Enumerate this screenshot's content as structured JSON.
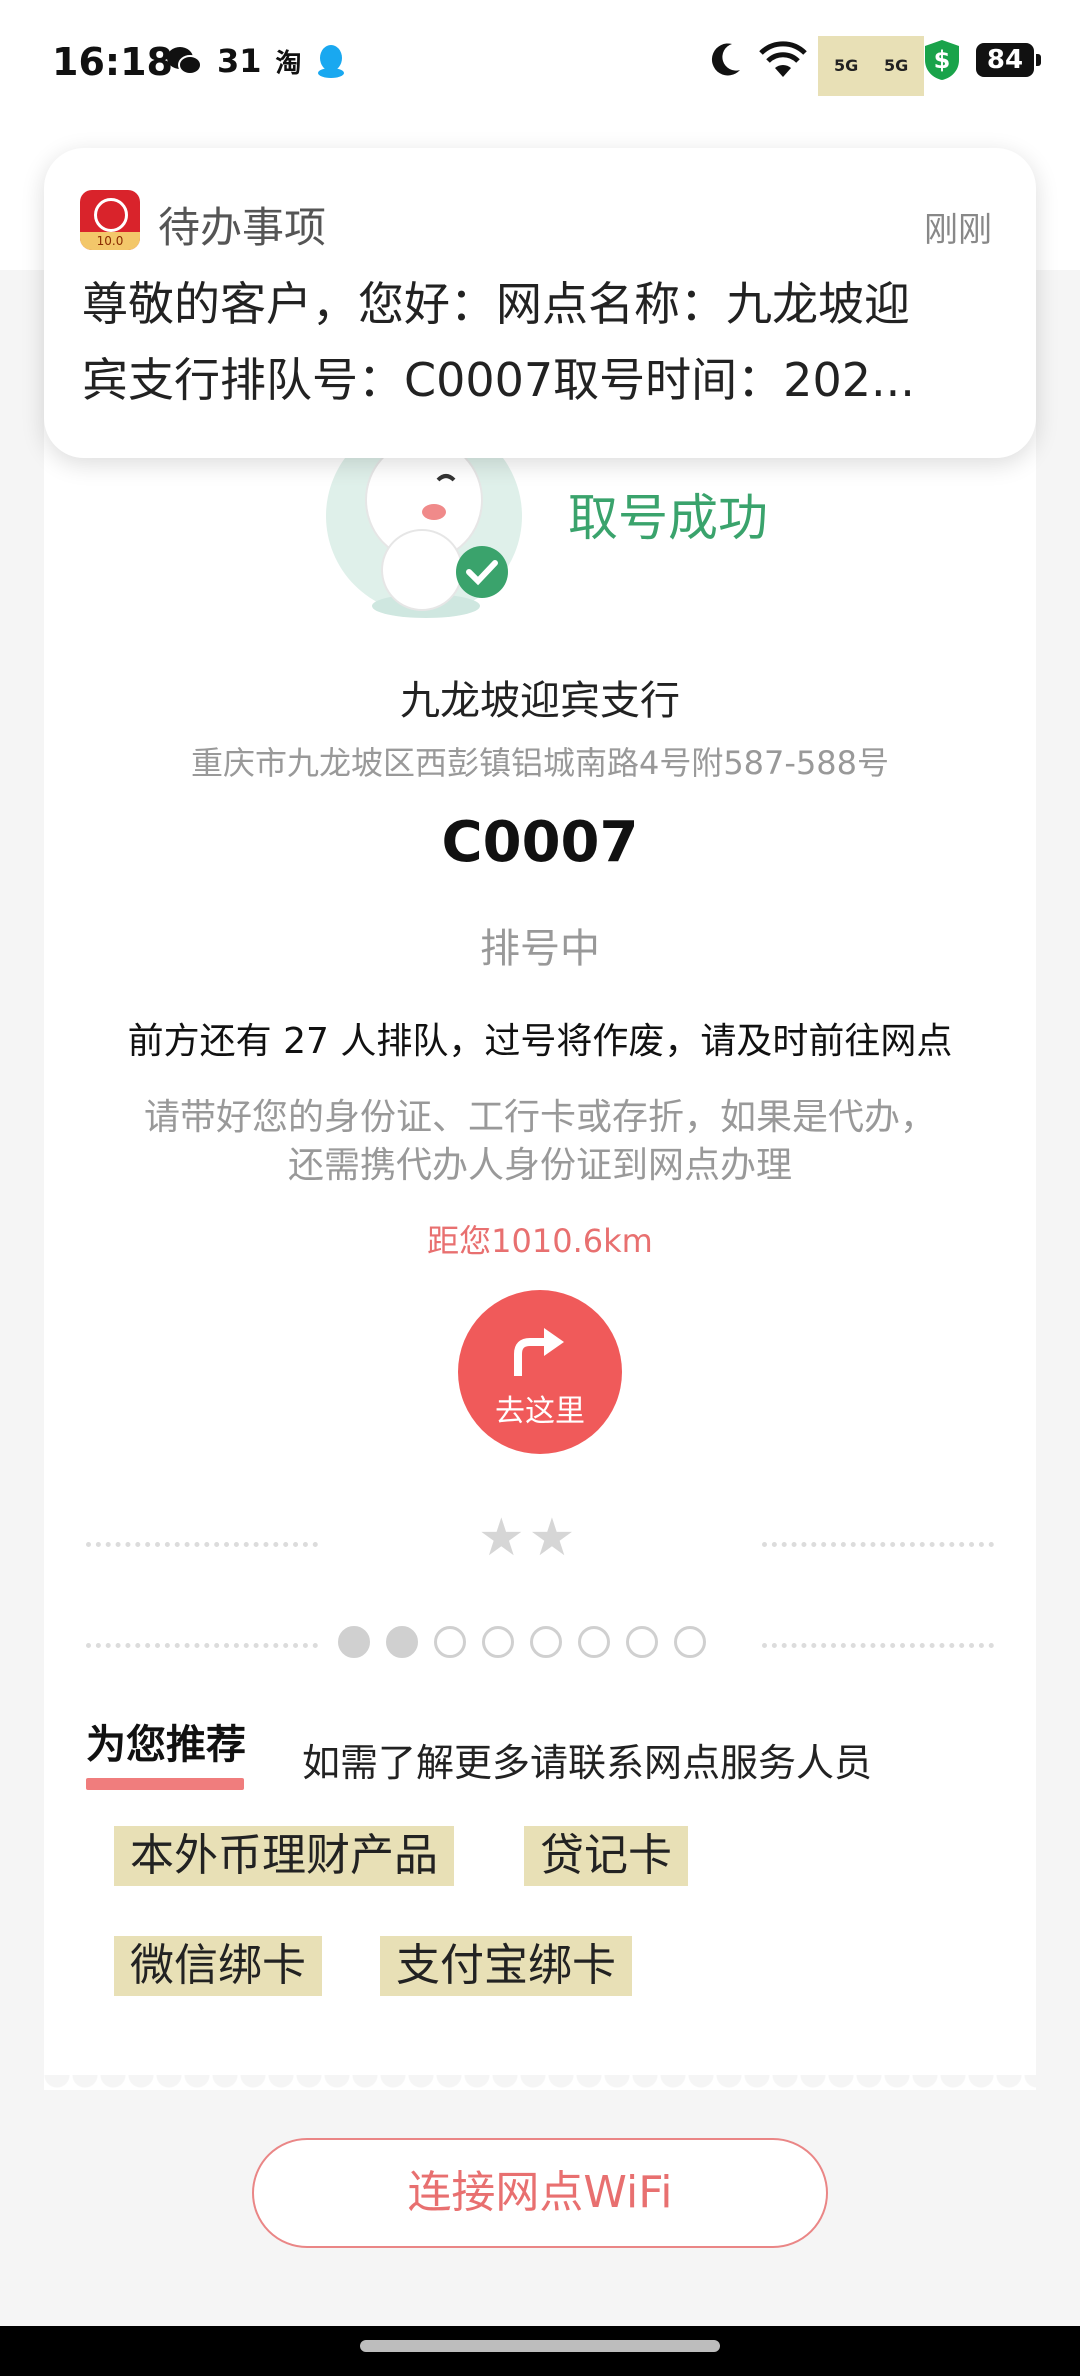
{
  "status_bar": {
    "time": "16:18",
    "wechat_count": "31",
    "taobao_label": "淘",
    "signal_tags": [
      "5G",
      "5G"
    ],
    "battery": "84"
  },
  "notification": {
    "app_name": "待办事项",
    "time": "刚刚",
    "line1": "尊敬的客户，您好：网点名称：九龙坡迎",
    "line2": "宾支行排队号：C0007取号时间：202..."
  },
  "ticket": {
    "success_text": "取号成功",
    "branch_name": "九龙坡迎宾支行",
    "branch_address": "重庆市九龙坡区西彭镇铝城南路4号附587-588号",
    "queue_number": "C0007",
    "queue_status": "排号中",
    "ahead_text": "前方还有 27 人排队，过号将作废，请及时前往网点",
    "notice_line1": "请带好您的身份证、工行卡或存折，如果是代办，",
    "notice_line2": "还需携代办人身份证到网点办理",
    "distance": "距您1010.6km",
    "go_button_label": "去这里",
    "stars": "★★",
    "pager": {
      "total": 8,
      "filled": 2
    }
  },
  "recommend": {
    "title": "为您推荐",
    "hint": "如需了解更多请联系网点服务人员",
    "tags": [
      "本外币理财产品",
      "贷记卡",
      "微信绑卡",
      "支付宝绑卡"
    ]
  },
  "wifi_button_label": "连接网点WiFi",
  "colors": {
    "accent_red": "#f05a5a",
    "success_green": "#3aa36c",
    "tag_bg": "#e8e0b6"
  }
}
